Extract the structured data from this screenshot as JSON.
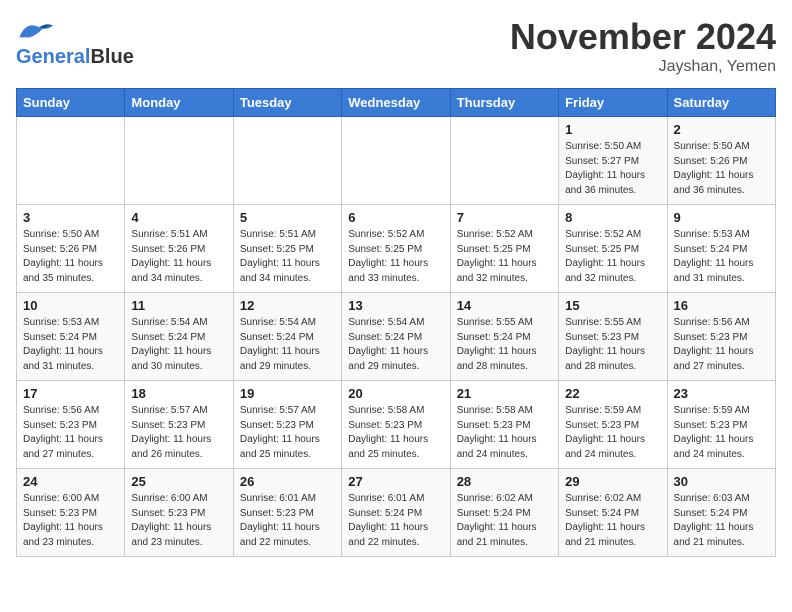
{
  "header": {
    "logo_line1": "General",
    "logo_line2": "Blue",
    "month": "November 2024",
    "location": "Jayshan, Yemen"
  },
  "weekdays": [
    "Sunday",
    "Monday",
    "Tuesday",
    "Wednesday",
    "Thursday",
    "Friday",
    "Saturday"
  ],
  "weeks": [
    [
      {
        "day": "",
        "info": ""
      },
      {
        "day": "",
        "info": ""
      },
      {
        "day": "",
        "info": ""
      },
      {
        "day": "",
        "info": ""
      },
      {
        "day": "",
        "info": ""
      },
      {
        "day": "1",
        "info": "Sunrise: 5:50 AM\nSunset: 5:27 PM\nDaylight: 11 hours\nand 36 minutes."
      },
      {
        "day": "2",
        "info": "Sunrise: 5:50 AM\nSunset: 5:26 PM\nDaylight: 11 hours\nand 36 minutes."
      }
    ],
    [
      {
        "day": "3",
        "info": "Sunrise: 5:50 AM\nSunset: 5:26 PM\nDaylight: 11 hours\nand 35 minutes."
      },
      {
        "day": "4",
        "info": "Sunrise: 5:51 AM\nSunset: 5:26 PM\nDaylight: 11 hours\nand 34 minutes."
      },
      {
        "day": "5",
        "info": "Sunrise: 5:51 AM\nSunset: 5:25 PM\nDaylight: 11 hours\nand 34 minutes."
      },
      {
        "day": "6",
        "info": "Sunrise: 5:52 AM\nSunset: 5:25 PM\nDaylight: 11 hours\nand 33 minutes."
      },
      {
        "day": "7",
        "info": "Sunrise: 5:52 AM\nSunset: 5:25 PM\nDaylight: 11 hours\nand 32 minutes."
      },
      {
        "day": "8",
        "info": "Sunrise: 5:52 AM\nSunset: 5:25 PM\nDaylight: 11 hours\nand 32 minutes."
      },
      {
        "day": "9",
        "info": "Sunrise: 5:53 AM\nSunset: 5:24 PM\nDaylight: 11 hours\nand 31 minutes."
      }
    ],
    [
      {
        "day": "10",
        "info": "Sunrise: 5:53 AM\nSunset: 5:24 PM\nDaylight: 11 hours\nand 31 minutes."
      },
      {
        "day": "11",
        "info": "Sunrise: 5:54 AM\nSunset: 5:24 PM\nDaylight: 11 hours\nand 30 minutes."
      },
      {
        "day": "12",
        "info": "Sunrise: 5:54 AM\nSunset: 5:24 PM\nDaylight: 11 hours\nand 29 minutes."
      },
      {
        "day": "13",
        "info": "Sunrise: 5:54 AM\nSunset: 5:24 PM\nDaylight: 11 hours\nand 29 minutes."
      },
      {
        "day": "14",
        "info": "Sunrise: 5:55 AM\nSunset: 5:24 PM\nDaylight: 11 hours\nand 28 minutes."
      },
      {
        "day": "15",
        "info": "Sunrise: 5:55 AM\nSunset: 5:23 PM\nDaylight: 11 hours\nand 28 minutes."
      },
      {
        "day": "16",
        "info": "Sunrise: 5:56 AM\nSunset: 5:23 PM\nDaylight: 11 hours\nand 27 minutes."
      }
    ],
    [
      {
        "day": "17",
        "info": "Sunrise: 5:56 AM\nSunset: 5:23 PM\nDaylight: 11 hours\nand 27 minutes."
      },
      {
        "day": "18",
        "info": "Sunrise: 5:57 AM\nSunset: 5:23 PM\nDaylight: 11 hours\nand 26 minutes."
      },
      {
        "day": "19",
        "info": "Sunrise: 5:57 AM\nSunset: 5:23 PM\nDaylight: 11 hours\nand 25 minutes."
      },
      {
        "day": "20",
        "info": "Sunrise: 5:58 AM\nSunset: 5:23 PM\nDaylight: 11 hours\nand 25 minutes."
      },
      {
        "day": "21",
        "info": "Sunrise: 5:58 AM\nSunset: 5:23 PM\nDaylight: 11 hours\nand 24 minutes."
      },
      {
        "day": "22",
        "info": "Sunrise: 5:59 AM\nSunset: 5:23 PM\nDaylight: 11 hours\nand 24 minutes."
      },
      {
        "day": "23",
        "info": "Sunrise: 5:59 AM\nSunset: 5:23 PM\nDaylight: 11 hours\nand 24 minutes."
      }
    ],
    [
      {
        "day": "24",
        "info": "Sunrise: 6:00 AM\nSunset: 5:23 PM\nDaylight: 11 hours\nand 23 minutes."
      },
      {
        "day": "25",
        "info": "Sunrise: 6:00 AM\nSunset: 5:23 PM\nDaylight: 11 hours\nand 23 minutes."
      },
      {
        "day": "26",
        "info": "Sunrise: 6:01 AM\nSunset: 5:23 PM\nDaylight: 11 hours\nand 22 minutes."
      },
      {
        "day": "27",
        "info": "Sunrise: 6:01 AM\nSunset: 5:24 PM\nDaylight: 11 hours\nand 22 minutes."
      },
      {
        "day": "28",
        "info": "Sunrise: 6:02 AM\nSunset: 5:24 PM\nDaylight: 11 hours\nand 21 minutes."
      },
      {
        "day": "29",
        "info": "Sunrise: 6:02 AM\nSunset: 5:24 PM\nDaylight: 11 hours\nand 21 minutes."
      },
      {
        "day": "30",
        "info": "Sunrise: 6:03 AM\nSunset: 5:24 PM\nDaylight: 11 hours\nand 21 minutes."
      }
    ]
  ]
}
